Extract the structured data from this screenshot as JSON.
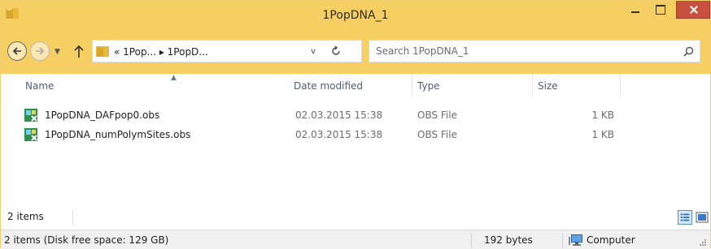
{
  "window": {
    "title": "1PopDNA_1"
  },
  "nav": {
    "back_icon": "back-arrow-icon",
    "forward_icon": "forward-arrow-icon",
    "up_icon": "up-arrow-icon",
    "address_path": "« 1Pop... ▸ 1PopD...",
    "search_placeholder": "Search 1PopDNA_1"
  },
  "columns": {
    "name": "Name",
    "date": "Date modified",
    "type": "Type",
    "size": "Size"
  },
  "files": [
    {
      "name": "1PopDNA_DAFpop0.obs",
      "date": "02.03.2015 15:38",
      "type": "OBS File",
      "size": "1 KB"
    },
    {
      "name": "1PopDNA_numPolymSites.obs",
      "date": "02.03.2015 15:38",
      "type": "OBS File",
      "size": "1 KB"
    }
  ],
  "items_bar": {
    "count": "2 items"
  },
  "status": {
    "free_space": "2 items (Disk free space: 129 GB)",
    "bytes": "192 bytes",
    "location": "Computer"
  },
  "colors": {
    "chrome": "#f6cf63",
    "close": "#c7503f",
    "header_text": "#4c607a"
  }
}
